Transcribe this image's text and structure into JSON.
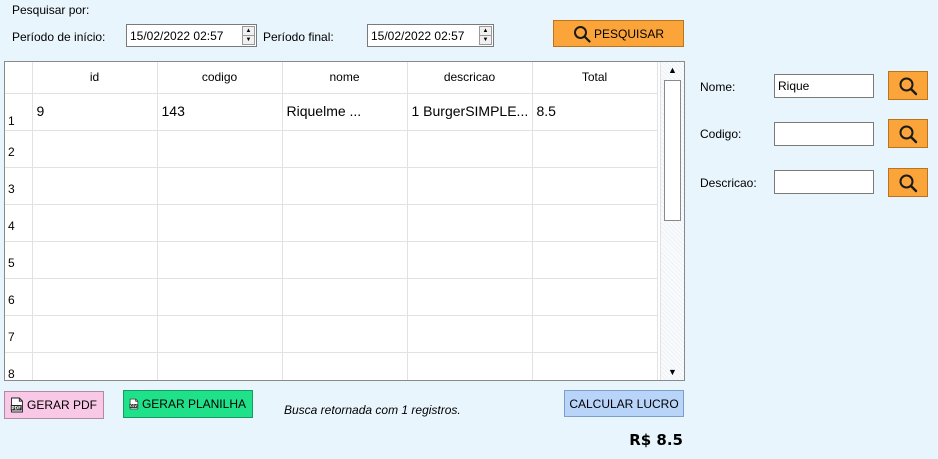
{
  "search": {
    "title": "Pesquisar por:",
    "start_label": "Período de início:",
    "start_value": "15/02/2022 02:57",
    "end_label": "Período final:",
    "end_value": "15/02/2022 02:57",
    "search_button": "PESQUISAR"
  },
  "table": {
    "columns": [
      "id",
      "codigo",
      "nome",
      "descricao",
      "Total"
    ],
    "row_numbers": [
      "1",
      "2",
      "3",
      "4",
      "5",
      "6",
      "7",
      "8"
    ],
    "rows": [
      [
        "9",
        "143",
        "Riquelme ...",
        "1 BurgerSIMPLE...",
        "8.5"
      ]
    ]
  },
  "filters": {
    "nome_label": "Nome:",
    "nome_value": "Rique",
    "codigo_label": "Codigo:",
    "codigo_value": "",
    "descricao_label": "Descricao:",
    "descricao_value": ""
  },
  "actions": {
    "pdf_label": "GERAR PDF",
    "pdf_icon_text": "PDF",
    "csv_label": "GERAR PLANILHA",
    "csv_icon_text": "CSV",
    "status_text": "Busca retornada com 1 registros.",
    "calc_label": "CALCULAR LUCRO",
    "total_text": "R$ 8.5"
  },
  "colors": {
    "background": "#e9f5fc",
    "orange_button": "#fba43a",
    "pdf_button": "#f8c8e6",
    "csv_button": "#1fe18a",
    "calc_button": "#b8d4f8"
  }
}
